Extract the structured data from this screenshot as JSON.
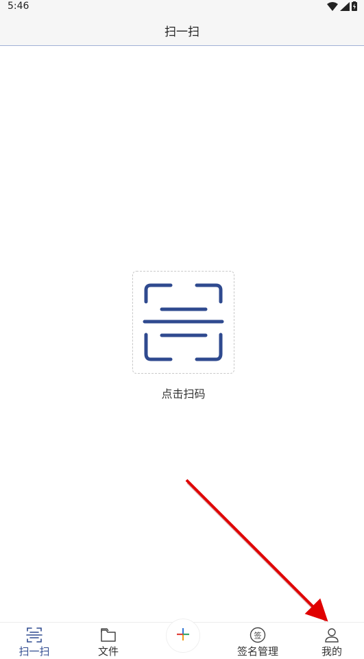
{
  "status_bar": {
    "time": "5:46",
    "icons": [
      "wifi-icon",
      "signal-icon",
      "battery-charging-icon"
    ]
  },
  "header": {
    "title": "扫一扫"
  },
  "main": {
    "scan_icon": "scan-frame-icon",
    "scan_label": "点击扫码",
    "accent_color": "#2f4a8f"
  },
  "bottom_nav": {
    "items": [
      {
        "label": "扫一扫",
        "icon": "scan-icon",
        "active": true
      },
      {
        "label": "文件",
        "icon": "folder-icon",
        "active": false
      },
      {
        "label": "",
        "icon": "plus-icon",
        "active": false
      },
      {
        "label": "签名管理",
        "icon": "signature-icon",
        "active": false
      },
      {
        "label": "我的",
        "icon": "user-icon",
        "active": false
      }
    ]
  },
  "annotation": {
    "type": "arrow",
    "color": "#e00000",
    "target": "我的"
  }
}
